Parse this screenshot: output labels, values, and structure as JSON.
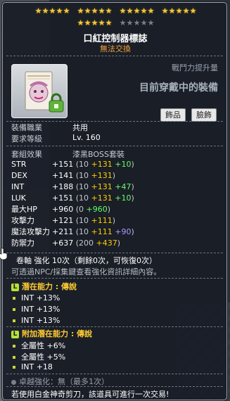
{
  "stars": {
    "row1": [
      [
        1,
        1,
        1,
        1,
        1
      ],
      [
        1,
        1,
        1,
        1,
        1
      ],
      [
        1,
        1,
        1,
        1,
        1
      ],
      [
        1,
        1,
        1,
        1,
        1
      ]
    ],
    "row2": [
      [
        1,
        1,
        1,
        1,
        1
      ],
      [
        0,
        0,
        0,
        0,
        0
      ]
    ]
  },
  "item": {
    "name": "口紅控制器標誌",
    "trade": "無法交換",
    "power_label": "戰鬥力提升量",
    "equipped_label": "目前穿戴中的裝備",
    "tags": [
      "飾品",
      "臉飾"
    ]
  },
  "requirements": [
    {
      "label": "裝備職業",
      "value": "共用"
    },
    {
      "label": "要求等級",
      "value": "Lv. 160"
    }
  ],
  "set_effect": {
    "label": "套組效果",
    "value": "漆黑BOSS套裝"
  },
  "stats": [
    {
      "name": "STR",
      "parts": [
        {
          "t": "+151",
          "c": "white"
        },
        {
          "t": " (10 ",
          "c": "gray"
        },
        {
          "t": "+131",
          "c": "yellow"
        },
        {
          "t": " ",
          "c": "gray"
        },
        {
          "t": "+10",
          "c": "green"
        },
        {
          "t": ")",
          "c": "gray"
        }
      ]
    },
    {
      "name": "DEX",
      "parts": [
        {
          "t": "+141",
          "c": "white"
        },
        {
          "t": " (10 ",
          "c": "gray"
        },
        {
          "t": "+131",
          "c": "yellow"
        },
        {
          "t": ")",
          "c": "gray"
        }
      ]
    },
    {
      "name": "INT",
      "parts": [
        {
          "t": "+188",
          "c": "white"
        },
        {
          "t": " (10 ",
          "c": "gray"
        },
        {
          "t": "+131",
          "c": "yellow"
        },
        {
          "t": " ",
          "c": "gray"
        },
        {
          "t": "+47",
          "c": "green"
        },
        {
          "t": ")",
          "c": "gray"
        }
      ]
    },
    {
      "name": "LUK",
      "parts": [
        {
          "t": "+151",
          "c": "white"
        },
        {
          "t": " (10 ",
          "c": "gray"
        },
        {
          "t": "+131",
          "c": "yellow"
        },
        {
          "t": " ",
          "c": "gray"
        },
        {
          "t": "+10",
          "c": "green"
        },
        {
          "t": ")",
          "c": "gray"
        }
      ]
    },
    {
      "name": "最大HP",
      "parts": [
        {
          "t": "+960",
          "c": "white"
        },
        {
          "t": " (0 ",
          "c": "gray"
        },
        {
          "t": "+960",
          "c": "green"
        },
        {
          "t": ")",
          "c": "gray"
        }
      ]
    },
    {
      "name": "攻擊力",
      "parts": [
        {
          "t": "+121",
          "c": "white"
        },
        {
          "t": " (10 ",
          "c": "gray"
        },
        {
          "t": "+111",
          "c": "yellow"
        },
        {
          "t": ")",
          "c": "gray"
        }
      ]
    },
    {
      "name": "魔法攻擊力",
      "parts": [
        {
          "t": "+211",
          "c": "white"
        },
        {
          "t": " (10 ",
          "c": "gray"
        },
        {
          "t": "+111",
          "c": "yellow"
        },
        {
          "t": " ",
          "c": "gray"
        },
        {
          "t": "+90",
          "c": "purple"
        },
        {
          "t": ")",
          "c": "gray"
        }
      ]
    },
    {
      "name": "防禦力",
      "parts": [
        {
          "t": "+637",
          "c": "white"
        },
        {
          "t": " (200 ",
          "c": "gray"
        },
        {
          "t": "+437",
          "c": "yellow"
        },
        {
          "t": ")",
          "c": "gray"
        }
      ]
    }
  ],
  "upgrade": {
    "text": "卷軸 強化 10次（剩餘0次，可恢復0次）",
    "hint": "可透過NPC/採集鍵查看強化資訊詳細內容。"
  },
  "potential": {
    "header": "潛在能力 : 傳說",
    "badge": "L",
    "lines": [
      "INT +13%",
      "INT +13%",
      "INT +13%"
    ]
  },
  "additional_potential": {
    "header": "附加潛在能力 : 傳說",
    "badge": "L",
    "lines": [
      "全屬性 +6%",
      "全屬性 +5%",
      "INT +18"
    ]
  },
  "transcendence": "卓越強化：無（最多1次）",
  "footer": "若使用白金神奇剪刀，該道具可進行一次交易!"
}
